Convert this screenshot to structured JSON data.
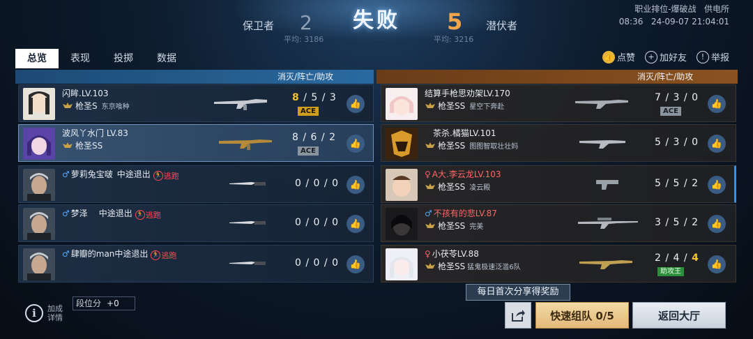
{
  "result": {
    "title": "失败"
  },
  "teams": {
    "left": {
      "name": "保卫者",
      "score": "2",
      "avg": "平均: 3186"
    },
    "right": {
      "name": "潜伏者",
      "score": "5",
      "avg": "平均: 3216"
    }
  },
  "header_info": {
    "mode": "职业排位-爆破战",
    "map": "供电所",
    "time": "08:36",
    "datetime": "24-09-07 21:04:01"
  },
  "tabs": [
    {
      "label": "总览",
      "active": true
    },
    {
      "label": "表现",
      "active": false
    },
    {
      "label": "投掷",
      "active": false
    },
    {
      "label": "数据",
      "active": false
    }
  ],
  "actions": {
    "like": "点赞",
    "add_friend": "加好友",
    "report": "举报"
  },
  "column_header": "消灭/阵亡/助攻",
  "left_players": [
    {
      "name": "闪眸.LV.103",
      "rank": "枪圣S",
      "title": "东京喰种",
      "k": "8",
      "d": "5",
      "a": "3",
      "kda_sep": "/",
      "badge": "ACE",
      "highlight": false,
      "quit": "",
      "escape": ""
    },
    {
      "name": "波风丫水门 LV.83",
      "rank": "枪圣SS",
      "title": "",
      "k": "8",
      "d": "6",
      "a": "2",
      "kda_sep": "/",
      "badge": "ACE",
      "highlight": true,
      "quit": "",
      "escape": ""
    },
    {
      "name": "萝莉兔宝啵",
      "rank": "",
      "title": "",
      "k": "0",
      "d": "0",
      "a": "0",
      "kda_sep": "/",
      "badge": "",
      "highlight": false,
      "quit": "中途退出",
      "escape": "逃跑"
    },
    {
      "name": "梦泽",
      "rank": "",
      "title": "",
      "k": "0",
      "d": "0",
      "a": "0",
      "kda_sep": "/",
      "badge": "",
      "highlight": false,
      "quit": "中途退出",
      "escape": "逃跑"
    },
    {
      "name": "肆瓣的man",
      "rank": "",
      "title": "",
      "k": "0",
      "d": "0",
      "a": "0",
      "kda_sep": "/",
      "badge": "",
      "highlight": false,
      "quit": "中途退出",
      "escape": "逃跑"
    }
  ],
  "right_players": [
    {
      "name": "结算手枪思劝架LV.170",
      "rank": "枪圣SS",
      "title": "星空下奔赴",
      "k": "7",
      "d": "3",
      "a": "0",
      "badge": "ACE",
      "highlight": false
    },
    {
      "name": "茶杀.橘猫LV.101",
      "rank": "枪圣SS",
      "title": "图图智取壮壮妈",
      "k": "5",
      "d": "3",
      "a": "0",
      "badge": "",
      "highlight": false
    },
    {
      "name": "A大.李云龙LV.103",
      "rank": "枪圣SS",
      "title": "凌云殿",
      "k": "5",
      "d": "5",
      "a": "2",
      "badge": "",
      "highlight": true
    },
    {
      "name": "不孩有的悲LV.87",
      "rank": "枪圣SS",
      "title": "完美",
      "k": "3",
      "d": "5",
      "a": "2",
      "badge": "",
      "highlight": false
    },
    {
      "name": "小茯苓LV.88",
      "rank": "枪圣SS",
      "title": "猛鬼极速泛滥6队",
      "k": "2",
      "d": "4",
      "a": "4",
      "badge": "助攻王",
      "highlight": false
    }
  ],
  "bottom": {
    "bonus_label": "加成详情",
    "rank_points_label": "段位分",
    "rank_points_value": "+0",
    "daily_tip": "每日首次分享得奖励",
    "quick_team": "快速组队 0/5",
    "back_lobby": "返回大厅"
  },
  "colors": {
    "left_accent": "#2a6aa0",
    "right_accent": "#8a5220",
    "kda_highlight": "#f4c32e",
    "escape": "#ff4b4b"
  }
}
